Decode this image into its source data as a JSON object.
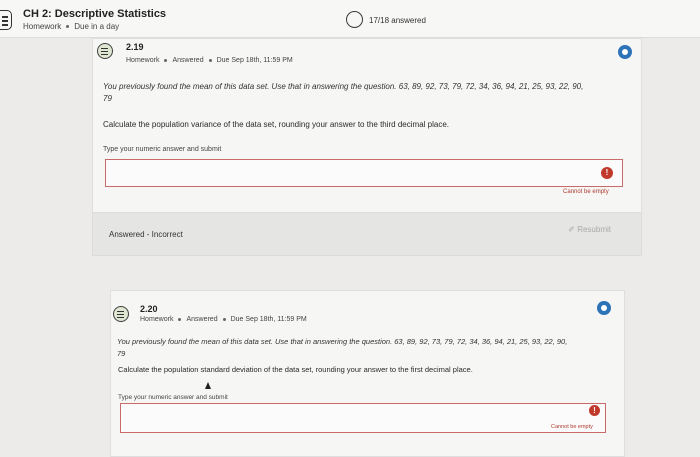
{
  "header": {
    "title": "CH 2: Descriptive Statistics",
    "category": "Homework",
    "due": "Due in a day",
    "progress": "17/18 answered"
  },
  "questions": [
    {
      "number": "2.19",
      "type": "Homework",
      "status": "Answered",
      "due": "Due Sep 18th, 11:59 PM",
      "body_line1": "You previously found the mean of this data set. Use that in answering the question. 63, 89, 92, 73, 79, 72, 34, 36, 94, 21, 25, 93, 22, 90,",
      "body_line2": "79",
      "prompt": "Calculate the population variance of the data set, rounding your answer to the third decimal place.",
      "hint": "Type your numeric answer and submit",
      "input_value": "",
      "error": "Cannot be empty",
      "result": "Answered - Incorrect",
      "resubmit_label": "Resubmit"
    },
    {
      "number": "2.20",
      "type": "Homework",
      "status": "Answered",
      "due": "Due Sep 18th, 11:59 PM",
      "body_line1": "You previously found the mean of this data set. Use that in answering the question. 63, 89, 92, 73, 79, 72, 34, 36, 94, 21, 25, 93, 22, 90,",
      "body_line2": "79",
      "prompt": "Calculate the population standard deviation of the data set, rounding your answer to the first decimal place.",
      "hint": "Type your numeric answer and submit",
      "input_value": "",
      "error": "Cannot be empty"
    }
  ],
  "colors": {
    "accent": "#2d73b8",
    "error": "#c0392b",
    "background": "#ecebea"
  },
  "icons": [
    "assignment-icon",
    "question-icon",
    "menu-dot-icon",
    "error-icon",
    "resubmit-icon",
    "progress-ring-icon"
  ]
}
